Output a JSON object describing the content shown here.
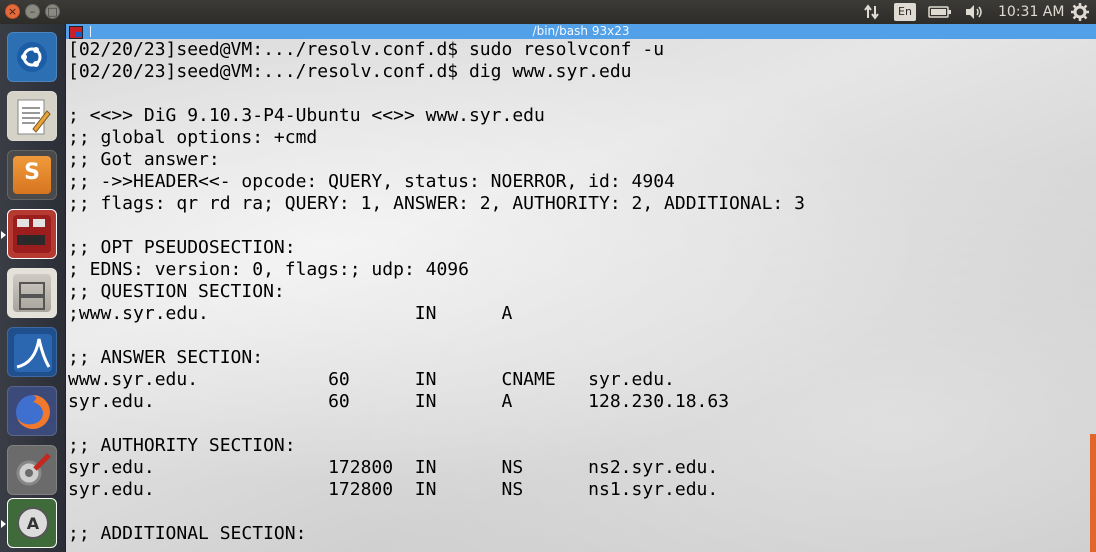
{
  "top_panel": {
    "window_title": "/bin/bash 93x23",
    "keyboard_indicator": "En",
    "clock": "10:31 AM",
    "icons": [
      "network-arrows-icon",
      "battery-icon",
      "volume-icon",
      "settings-gear-icon"
    ]
  },
  "launcher": {
    "items": [
      {
        "name": "ubuntu-dash",
        "icon": "ubuntu-logo-icon"
      },
      {
        "name": "text-editor",
        "icon": "notepad-pencil-icon"
      },
      {
        "name": "sublime-text",
        "icon": "sublime-s-icon"
      },
      {
        "name": "terminal",
        "icon": "terminal-icon",
        "active": true
      },
      {
        "name": "file-manager",
        "icon": "file-cabinet-icon"
      },
      {
        "name": "wireshark",
        "icon": "wireshark-fin-icon"
      },
      {
        "name": "firefox",
        "icon": "firefox-icon"
      },
      {
        "name": "system-settings",
        "icon": "settings-wrench-icon"
      },
      {
        "name": "software-updater",
        "icon": "updater-a-icon"
      }
    ]
  },
  "terminal": {
    "lines": [
      "[02/20/23]seed@VM:.../resolv.conf.d$ sudo resolvconf -u",
      "[02/20/23]seed@VM:.../resolv.conf.d$ dig www.syr.edu",
      "",
      "; <<>> DiG 9.10.3-P4-Ubuntu <<>> www.syr.edu",
      ";; global options: +cmd",
      ";; Got answer:",
      ";; ->>HEADER<<- opcode: QUERY, status: NOERROR, id: 4904",
      ";; flags: qr rd ra; QUERY: 1, ANSWER: 2, AUTHORITY: 2, ADDITIONAL: 3",
      "",
      ";; OPT PSEUDOSECTION:",
      "; EDNS: version: 0, flags:; udp: 4096",
      ";; QUESTION SECTION:",
      ";www.syr.edu.                   IN      A",
      "",
      ";; ANSWER SECTION:",
      "www.syr.edu.            60      IN      CNAME   syr.edu.",
      "syr.edu.                60      IN      A       128.230.18.63",
      "",
      ";; AUTHORITY SECTION:",
      "syr.edu.                172800  IN      NS      ns2.syr.edu.",
      "syr.edu.                172800  IN      NS      ns1.syr.edu.",
      "",
      ";; ADDITIONAL SECTION:"
    ]
  },
  "colors": {
    "title_bar": "#52a0e8",
    "panel": "#3c3b37",
    "scroll_indicator": "#e0662c"
  }
}
